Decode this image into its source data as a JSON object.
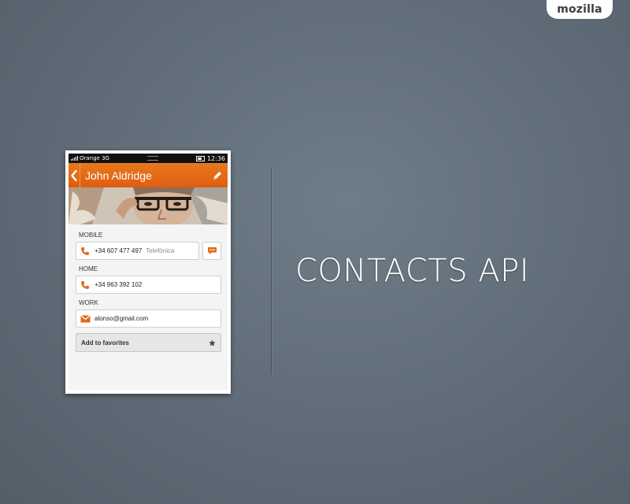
{
  "brand": {
    "logo": "mozilla"
  },
  "slide": {
    "title": "CONTACTS API"
  },
  "phone": {
    "status": {
      "carrier": "Orange 3G",
      "time": "12:36"
    },
    "header": {
      "title": "John Aldridge"
    },
    "fields": [
      {
        "label": "MOBILE",
        "value": "+34 607 477 497",
        "extra": "Telefónica",
        "icon": "phone-icon",
        "action_icon": "message-icon"
      },
      {
        "label": "HOME",
        "value": "+34 963 392 102",
        "icon": "phone-icon"
      },
      {
        "label": "WORK",
        "value": "alonso@gmail.com",
        "icon": "mail-icon"
      }
    ],
    "favorite": {
      "label": "Add to favorites",
      "icon": "star-icon"
    }
  },
  "colors": {
    "accent": "#e26a16",
    "background": "#5f6c77"
  }
}
